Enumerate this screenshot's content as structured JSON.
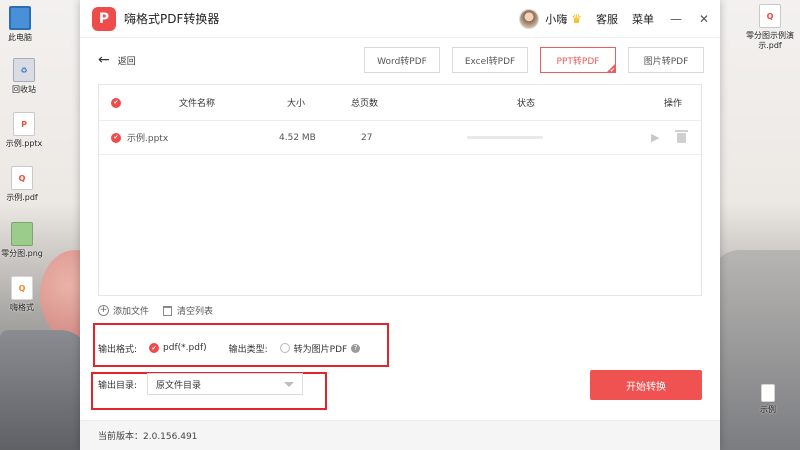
{
  "desktop": {
    "icons_left": [
      {
        "label": "此电脑",
        "icon": "computer-icon"
      },
      {
        "label": "回收站",
        "icon": "recycle-bin-icon"
      },
      {
        "label": "示例.pptx",
        "icon": "pptx-file-icon"
      },
      {
        "label": "示例.pdf",
        "icon": "pdf-file-icon"
      },
      {
        "label": "零分图.png",
        "icon": "png-file-icon"
      },
      {
        "label": "嗨格式",
        "icon": "app-shortcut-icon"
      }
    ],
    "icons_right": [
      {
        "label": "零分图示例演示.pdf",
        "icon": "pdf-file-icon"
      },
      {
        "label": "示例",
        "icon": "file-icon"
      }
    ]
  },
  "app": {
    "logo_glyph": "P",
    "title": "嗨格式PDF转换器",
    "user": {
      "name": "小嗨",
      "badge_glyph": "♛"
    },
    "links": {
      "service": "客服",
      "menu": "菜单"
    },
    "window_controls": {
      "minimize": "—",
      "close": "✕"
    },
    "back_label": "返回",
    "modes": [
      {
        "label": "Word转PDF",
        "active": false
      },
      {
        "label": "Excel转PDF",
        "active": false
      },
      {
        "label": "PPT转PDF",
        "active": true
      },
      {
        "label": "图片转PDF",
        "active": false
      }
    ],
    "table": {
      "columns": {
        "name": "文件名称",
        "size": "大小",
        "pages": "总页数",
        "status": "状态",
        "action": "操作"
      },
      "rows": [
        {
          "name": "示例.pptx",
          "size": "4.52 MB",
          "pages": "27",
          "progress": 0
        }
      ]
    },
    "list_actions": {
      "add": "添加文件",
      "clear": "清空列表"
    },
    "output_format": {
      "label": "输出格式:",
      "value": "pdf(*.pdf)"
    },
    "output_type": {
      "label": "输出类型:",
      "option": "转为图片PDF",
      "checked": false
    },
    "output_dir": {
      "label": "输出目录:",
      "value": "原文件目录"
    },
    "start_label": "开始转换",
    "version": "当前版本：2.0.156.491",
    "accent_color": "#F05252",
    "highlight_color": "#E0262C"
  }
}
